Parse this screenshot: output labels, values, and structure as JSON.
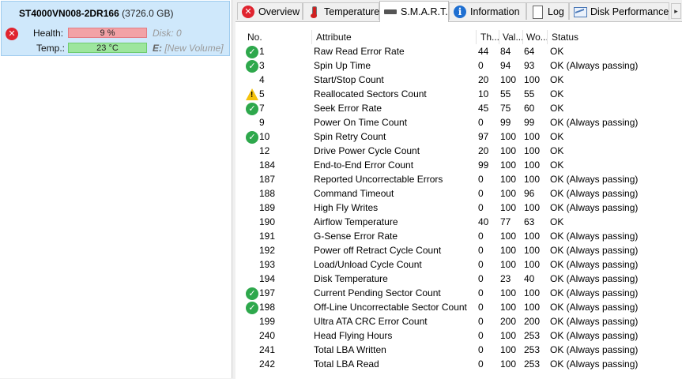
{
  "drive": {
    "model": "ST4000VN008-2DR166",
    "capacity": "(3726.0 GB)",
    "health_label": "Health:",
    "health_value": "9 %",
    "temp_label": "Temp.:",
    "temp_value": "23 °C",
    "disk_label": "Disk:",
    "disk_value": "0",
    "volume_letter": "E:",
    "volume_name": "[New Volume]",
    "status": "bad"
  },
  "tabs": [
    {
      "label": "Overview",
      "icon": "red-x-icon"
    },
    {
      "label": "Temperature",
      "icon": "thermometer-icon"
    },
    {
      "label": "S.M.A.R.T.",
      "icon": "drive-icon",
      "active": true
    },
    {
      "label": "Information",
      "icon": "info-icon"
    },
    {
      "label": "Log",
      "icon": "log-icon"
    },
    {
      "label": "Disk Performance",
      "icon": "chart-icon"
    }
  ],
  "columns": [
    "No.",
    "Attribute",
    "Th...",
    "Val...",
    "Wo...",
    "Status"
  ],
  "rows": [
    {
      "no": "1",
      "attr": "Raw Read Error Rate",
      "th": "44",
      "val": "84",
      "wo": "64",
      "status": "OK",
      "icon": "ok"
    },
    {
      "no": "3",
      "attr": "Spin Up Time",
      "th": "0",
      "val": "94",
      "wo": "93",
      "status": "OK (Always passing)",
      "icon": "ok"
    },
    {
      "no": "4",
      "attr": "Start/Stop Count",
      "th": "20",
      "val": "100",
      "wo": "100",
      "status": "OK",
      "icon": ""
    },
    {
      "no": "5",
      "attr": "Reallocated Sectors Count",
      "th": "10",
      "val": "55",
      "wo": "55",
      "status": "OK",
      "icon": "warn"
    },
    {
      "no": "7",
      "attr": "Seek Error Rate",
      "th": "45",
      "val": "75",
      "wo": "60",
      "status": "OK",
      "icon": "ok"
    },
    {
      "no": "9",
      "attr": "Power On Time Count",
      "th": "0",
      "val": "99",
      "wo": "99",
      "status": "OK (Always passing)",
      "icon": ""
    },
    {
      "no": "10",
      "attr": "Spin Retry Count",
      "th": "97",
      "val": "100",
      "wo": "100",
      "status": "OK",
      "icon": "ok"
    },
    {
      "no": "12",
      "attr": "Drive Power Cycle Count",
      "th": "20",
      "val": "100",
      "wo": "100",
      "status": "OK",
      "icon": ""
    },
    {
      "no": "184",
      "attr": "End-to-End Error Count",
      "th": "99",
      "val": "100",
      "wo": "100",
      "status": "OK",
      "icon": ""
    },
    {
      "no": "187",
      "attr": "Reported Uncorrectable Errors",
      "th": "0",
      "val": "100",
      "wo": "100",
      "status": "OK (Always passing)",
      "icon": ""
    },
    {
      "no": "188",
      "attr": "Command Timeout",
      "th": "0",
      "val": "100",
      "wo": "96",
      "status": "OK (Always passing)",
      "icon": ""
    },
    {
      "no": "189",
      "attr": "High Fly Writes",
      "th": "0",
      "val": "100",
      "wo": "100",
      "status": "OK (Always passing)",
      "icon": ""
    },
    {
      "no": "190",
      "attr": "Airflow Temperature",
      "th": "40",
      "val": "77",
      "wo": "63",
      "status": "OK",
      "icon": ""
    },
    {
      "no": "191",
      "attr": "G-Sense Error Rate",
      "th": "0",
      "val": "100",
      "wo": "100",
      "status": "OK (Always passing)",
      "icon": ""
    },
    {
      "no": "192",
      "attr": "Power off Retract Cycle Count",
      "th": "0",
      "val": "100",
      "wo": "100",
      "status": "OK (Always passing)",
      "icon": ""
    },
    {
      "no": "193",
      "attr": "Load/Unload Cycle Count",
      "th": "0",
      "val": "100",
      "wo": "100",
      "status": "OK (Always passing)",
      "icon": ""
    },
    {
      "no": "194",
      "attr": "Disk Temperature",
      "th": "0",
      "val": "23",
      "wo": "40",
      "status": "OK (Always passing)",
      "icon": ""
    },
    {
      "no": "197",
      "attr": "Current Pending Sector Count",
      "th": "0",
      "val": "100",
      "wo": "100",
      "status": "OK (Always passing)",
      "icon": "ok"
    },
    {
      "no": "198",
      "attr": "Off-Line Uncorrectable Sector Count",
      "th": "0",
      "val": "100",
      "wo": "100",
      "status": "OK (Always passing)",
      "icon": "ok"
    },
    {
      "no": "199",
      "attr": "Ultra ATA CRC Error Count",
      "th": "0",
      "val": "200",
      "wo": "200",
      "status": "OK (Always passing)",
      "icon": ""
    },
    {
      "no": "240",
      "attr": "Head Flying Hours",
      "th": "0",
      "val": "100",
      "wo": "253",
      "status": "OK (Always passing)",
      "icon": ""
    },
    {
      "no": "241",
      "attr": "Total LBA Written",
      "th": "0",
      "val": "100",
      "wo": "253",
      "status": "OK (Always passing)",
      "icon": ""
    },
    {
      "no": "242",
      "attr": "Total LBA Read",
      "th": "0",
      "val": "100",
      "wo": "253",
      "status": "OK (Always passing)",
      "icon": ""
    }
  ]
}
